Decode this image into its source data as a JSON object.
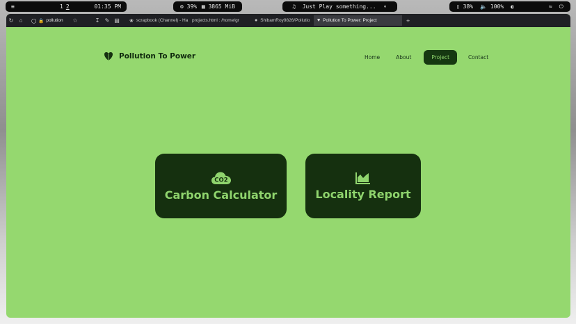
{
  "system_bar": {
    "workspaces": [
      "1",
      "2"
    ],
    "time": "01:35 PM",
    "cpu": "39%",
    "memory": "3865 MiB",
    "music": "Just Play something...",
    "battery": "38%",
    "volume": "100%"
  },
  "browser": {
    "url": "pollution",
    "tabs": [
      {
        "label": "scrapbook (Channel) - Ha",
        "icon": "slack-icon"
      },
      {
        "label": "projects.html : /home/gr",
        "icon": "file-icon"
      },
      {
        "label": "ShibamRoy9826/Pollutio",
        "icon": "github-icon"
      },
      {
        "label": "Pollution To Power: Project",
        "icon": "leaf-icon",
        "active": true
      }
    ]
  },
  "site": {
    "brand": "Pollution To Power",
    "nav": {
      "home": "Home",
      "about": "About",
      "project": "Project",
      "contact": "Contact"
    },
    "cards": {
      "carbon": {
        "title": "Carbon Calculator",
        "icon_text": "CO2"
      },
      "locality": {
        "title": "Locality Report"
      }
    }
  },
  "colors": {
    "page_bg": "#95d86f",
    "card_bg": "#15300f",
    "accent_text": "#8fd46d"
  }
}
